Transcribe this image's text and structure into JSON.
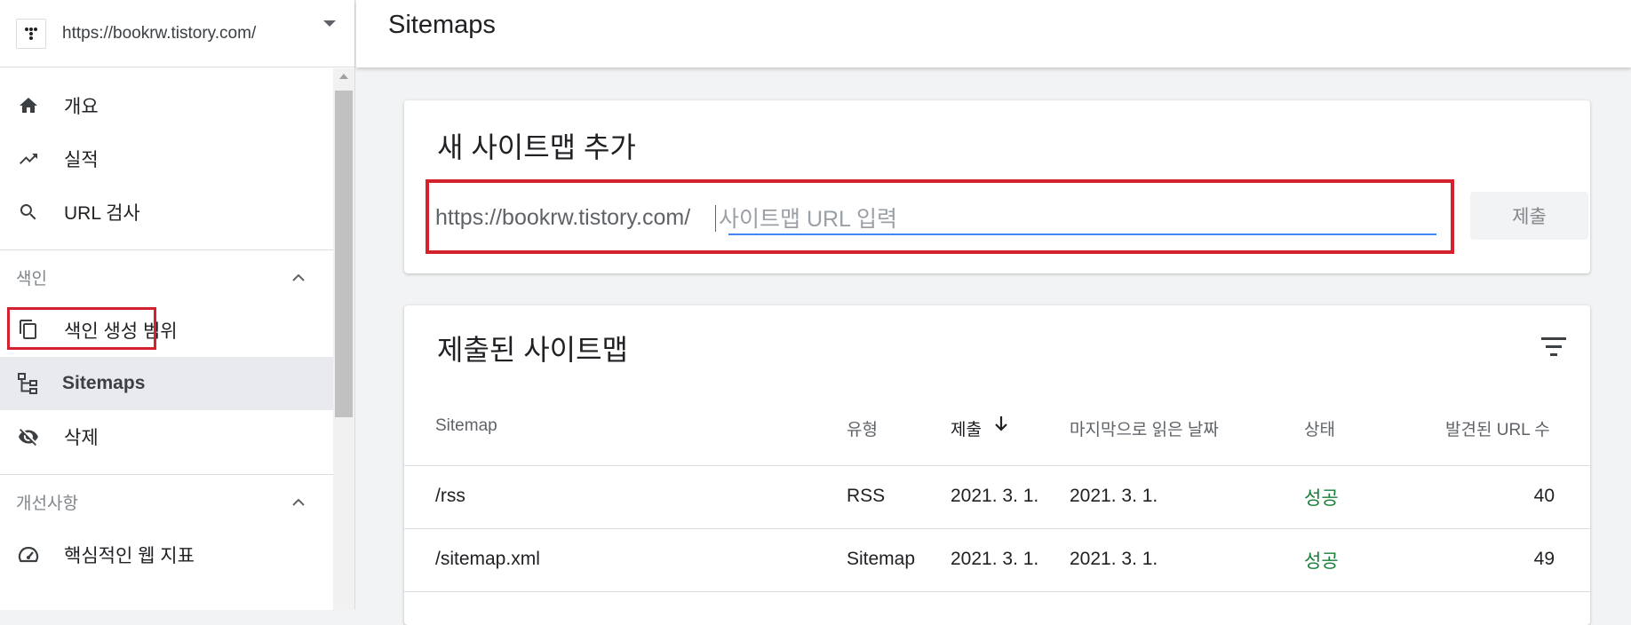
{
  "sidebar": {
    "property_url": "https://bookrw.tistory.com/",
    "items_top": [
      {
        "label": "개요",
        "icon": "home-icon"
      },
      {
        "label": "실적",
        "icon": "trending-up-icon"
      },
      {
        "label": "URL 검사",
        "icon": "search-icon"
      }
    ],
    "section_index": {
      "label": "색인",
      "items": [
        {
          "label": "색인 생성 범위",
          "icon": "coverage-icon"
        },
        {
          "label": "Sitemaps",
          "icon": "sitemap-icon"
        },
        {
          "label": "삭제",
          "icon": "visibility-off-icon"
        }
      ]
    },
    "section_enhancements": {
      "label": "개선사항",
      "items": [
        {
          "label": "핵심적인 웹 지표",
          "icon": "speed-gauge-icon"
        }
      ]
    }
  },
  "header": {
    "title": "Sitemaps"
  },
  "add_sitemap": {
    "title": "새 사이트맵 추가",
    "prefix": "https://bookrw.tistory.com/",
    "placeholder": "사이트맵 URL 입력",
    "submit_label": "제출"
  },
  "submitted": {
    "title": "제출된 사이트맵",
    "columns": [
      "Sitemap",
      "유형",
      "제출",
      "마지막으로 읽은 날짜",
      "상태",
      "발견된 URL 수"
    ],
    "rows": [
      {
        "sitemap": "/rss",
        "type": "RSS",
        "submitted": "2021. 3. 1.",
        "last_read": "2021. 3. 1.",
        "status": "성공",
        "urls": "40"
      },
      {
        "sitemap": "/sitemap.xml",
        "type": "Sitemap",
        "submitted": "2021. 3. 1.",
        "last_read": "2021. 3. 1.",
        "status": "성공",
        "urls": "49"
      }
    ]
  },
  "colors": {
    "highlight": "#d3212d",
    "accent": "#4285f4",
    "success": "#188038"
  }
}
